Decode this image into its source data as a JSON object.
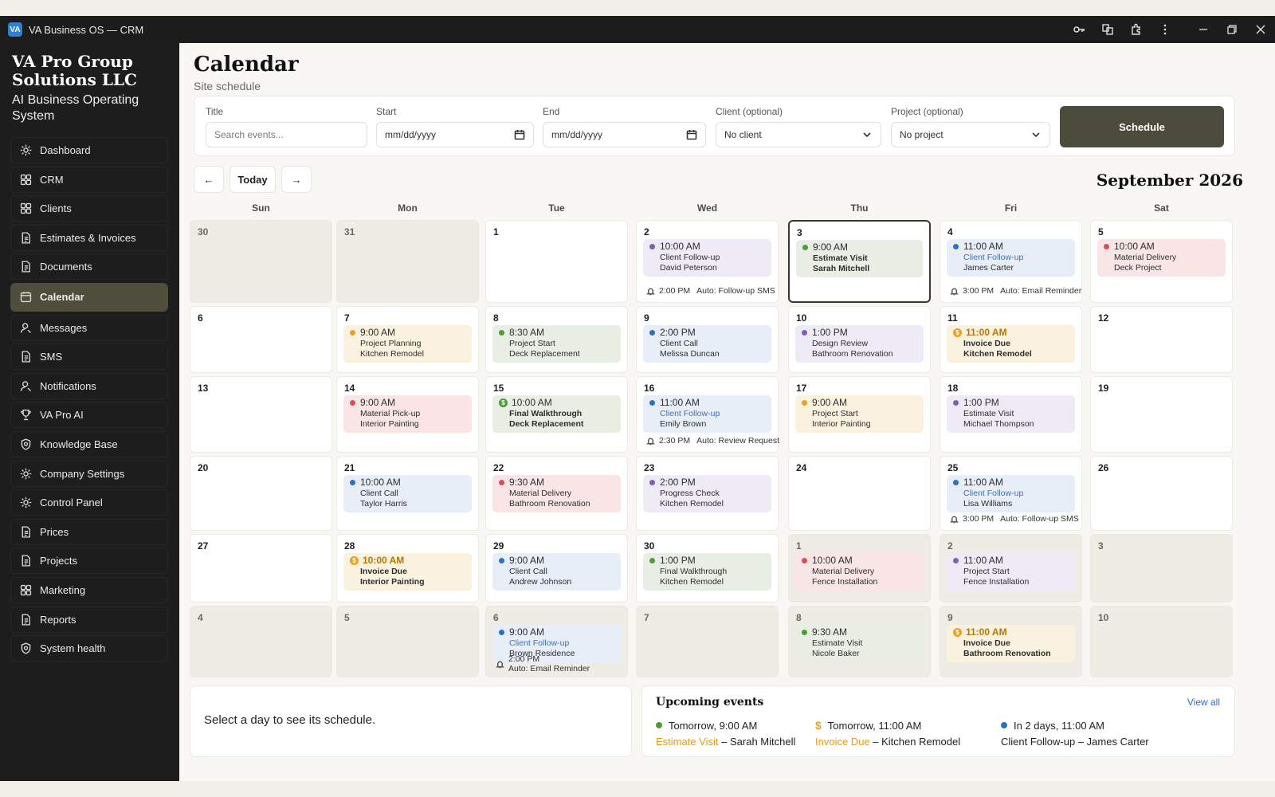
{
  "window": {
    "badge": "VA",
    "title": "VA Business OS — CRM"
  },
  "sidebar": {
    "company": "VA Pro Group Solutions LLC",
    "tagline": "AI Business Operating System",
    "items": [
      {
        "label": "Dashboard",
        "icon": "gear-icon"
      },
      {
        "label": "CRM",
        "icon": "grid-icon"
      },
      {
        "label": "Clients",
        "icon": "grid-icon"
      },
      {
        "label": "Estimates & Invoices",
        "icon": "document-icon"
      },
      {
        "label": "Documents",
        "icon": "document-icon"
      },
      {
        "label": "Calendar",
        "icon": "calendar-icon",
        "active": true
      },
      {
        "label": "Messages",
        "icon": "user-icon"
      },
      {
        "label": "SMS",
        "icon": "document-icon"
      },
      {
        "label": "Notifications",
        "icon": "user-icon"
      },
      {
        "label": "VA Pro AI",
        "icon": "trophy-icon"
      },
      {
        "label": "Knowledge Base",
        "icon": "shield-icon"
      },
      {
        "label": "Company Settings",
        "icon": "gear-icon"
      },
      {
        "label": "Control Panel",
        "icon": "gear-icon"
      },
      {
        "label": "Prices",
        "icon": "document-icon"
      },
      {
        "label": "Projects",
        "icon": "document-icon"
      },
      {
        "label": "Marketing",
        "icon": "grid-icon"
      },
      {
        "label": "Reports",
        "icon": "document-icon"
      },
      {
        "label": "System health",
        "icon": "shield-icon"
      }
    ]
  },
  "page": {
    "title": "Calendar",
    "subtitle": "Site schedule"
  },
  "form": {
    "title_label": "Title",
    "title_placeholder": "Search events...",
    "start_label": "Start",
    "start_value": "mm/dd/yyyy",
    "end_label": "End",
    "end_value": "mm/dd/yyyy",
    "client_label": "Client (optional)",
    "client_value": "No client",
    "project_label": "Project (optional)",
    "project_value": "No project",
    "schedule_label": "Schedule"
  },
  "calnav": {
    "prev": "←",
    "today": "Today",
    "next": "→",
    "month": "September 2026"
  },
  "weekdays": [
    "Sun",
    "Mon",
    "Tue",
    "Wed",
    "Thu",
    "Fri",
    "Sat"
  ],
  "colors": {
    "purple": "#7e5fb1",
    "blue": "#2c6fc1",
    "green": "#4e9b38",
    "orange": "#e8a125",
    "red": "#d05060",
    "accent": "#4c4c3c"
  },
  "weeks": [
    [
      {
        "day": "30",
        "out": true
      },
      {
        "day": "31",
        "out": true
      },
      {
        "day": "1"
      },
      {
        "day": "2",
        "events": [
          {
            "color": "purple",
            "time": "10:00 AM",
            "line1": "Client Follow-up",
            "line2": "David Peterson"
          }
        ],
        "reminder": {
          "time": "2:00 PM",
          "text": "Auto: Follow-up SMS"
        }
      },
      {
        "day": "3",
        "today": true,
        "events": [
          {
            "color": "green",
            "time": "9:00 AM",
            "line1": "Estimate Visit",
            "line2": "Sarah Mitchell",
            "bold": true
          }
        ]
      },
      {
        "day": "4",
        "events": [
          {
            "color": "blue",
            "time": "11:00 AM",
            "line1": "Client Follow-up",
            "line2": "James Carter"
          }
        ],
        "reminder": {
          "time": "3:00 PM",
          "text": "Auto: Email Reminder"
        }
      },
      {
        "day": "5",
        "events": [
          {
            "color": "red",
            "time": "10:00 AM",
            "line1": "Material Delivery",
            "line2": "Deck Project"
          }
        ]
      }
    ],
    [
      {
        "day": "6"
      },
      {
        "day": "7",
        "events": [
          {
            "color": "orange",
            "time": "9:00 AM",
            "line1": "Project Planning",
            "line2": "Kitchen Remodel"
          }
        ]
      },
      {
        "day": "8",
        "events": [
          {
            "color": "green",
            "time": "8:30 AM",
            "line1": "Project Start",
            "line2": "Deck Replacement"
          }
        ]
      },
      {
        "day": "9",
        "events": [
          {
            "color": "blue",
            "time": "2:00 PM",
            "line1": "Client Call",
            "line2": "Melissa Duncan"
          }
        ]
      },
      {
        "day": "10",
        "events": [
          {
            "color": "purple",
            "time": "1:00 PM",
            "line1": "Design Review",
            "line2": "Bathroom Renovation"
          }
        ]
      },
      {
        "day": "11",
        "events": [
          {
            "color": "orange",
            "time": "11:00 AM",
            "line1": "Invoice Due",
            "line2": "Kitchen Remodel",
            "coin": "$",
            "bold": true
          }
        ]
      },
      {
        "day": "12"
      }
    ],
    [
      {
        "day": "13"
      },
      {
        "day": "14",
        "events": [
          {
            "color": "red",
            "time": "9:00 AM",
            "line1": "Material Pick-up",
            "line2": "Interior Painting"
          }
        ]
      },
      {
        "day": "15",
        "events": [
          {
            "color": "green",
            "time": "10:00 AM",
            "line1": "Final Walkthrough",
            "line2": "Deck Replacement",
            "coin": "$",
            "bold": true
          }
        ]
      },
      {
        "day": "16",
        "events": [
          {
            "color": "blue",
            "time": "11:00 AM",
            "line1": "Client Follow-up",
            "line2": "Emily Brown"
          }
        ],
        "reminder": {
          "time": "2:30 PM",
          "text": "Auto: Review Request"
        }
      },
      {
        "day": "17",
        "events": [
          {
            "color": "orange",
            "time": "9:00 AM",
            "line1": "Project Start",
            "line2": "Interior Painting"
          }
        ]
      },
      {
        "day": "18",
        "events": [
          {
            "color": "purple",
            "time": "1:00 PM",
            "line1": "Estimate Visit",
            "line2": "Michael Thompson"
          }
        ]
      },
      {
        "day": "19"
      }
    ],
    [
      {
        "day": "20"
      },
      {
        "day": "21",
        "events": [
          {
            "color": "blue",
            "time": "10:00 AM",
            "line1": "Client Call",
            "line2": "Taylor Harris"
          }
        ]
      },
      {
        "day": "22",
        "events": [
          {
            "color": "red",
            "time": "9:30 AM",
            "line1": "Material Delivery",
            "line2": "Bathroom Renovation"
          }
        ]
      },
      {
        "day": "23",
        "events": [
          {
            "color": "purple",
            "time": "2:00 PM",
            "line1": "Progress Check",
            "line2": "Kitchen Remodel"
          }
        ]
      },
      {
        "day": "24"
      },
      {
        "day": "25",
        "events": [
          {
            "color": "blue",
            "time": "11:00 AM",
            "line1": "Client Follow-up",
            "line2": "Lisa Williams"
          }
        ],
        "reminder": {
          "time": "3:00 PM",
          "text": "Auto: Follow-up SMS"
        }
      },
      {
        "day": "26"
      }
    ],
    [
      {
        "day": "27"
      },
      {
        "day": "28",
        "events": [
          {
            "color": "orange",
            "time": "10:00 AM",
            "line1": "Invoice Due",
            "line2": "Interior Painting",
            "coin": "$",
            "bold": true
          }
        ]
      },
      {
        "day": "29",
        "events": [
          {
            "color": "blue",
            "time": "9:00 AM",
            "line1": "Client Call",
            "line2": "Andrew Johnson"
          }
        ]
      },
      {
        "day": "30",
        "events": [
          {
            "color": "green",
            "time": "1:00 PM",
            "line1": "Final Walkthrough",
            "line2": "Kitchen Remodel"
          }
        ]
      },
      {
        "day": "1",
        "out": true,
        "events": [
          {
            "color": "red",
            "time": "10:00 AM",
            "line1": "Material Delivery",
            "line2": "Fence Installation"
          }
        ]
      },
      {
        "day": "2",
        "out": true,
        "events": [
          {
            "color": "purple",
            "time": "11:00 AM",
            "line1": "Project Start",
            "line2": "Fence Installation"
          }
        ]
      },
      {
        "day": "3",
        "out": true
      }
    ],
    [
      {
        "day": "4",
        "out": true
      },
      {
        "day": "5",
        "out": true
      },
      {
        "day": "6",
        "out": true,
        "events": [
          {
            "color": "blue",
            "time": "9:00 AM",
            "line1": "Client Follow-up",
            "line2": "Brown Residence"
          }
        ],
        "reminder": {
          "time": "2:00 PM",
          "text": "Auto: Email Reminder",
          "stacked": true
        }
      },
      {
        "day": "7",
        "out": true
      },
      {
        "day": "8",
        "out": true,
        "events": [
          {
            "color": "green",
            "time": "9:30 AM",
            "line1": "Estimate Visit",
            "line2": "Nicole Baker"
          }
        ]
      },
      {
        "day": "9",
        "out": true,
        "events": [
          {
            "color": "orange",
            "time": "11:00 AM",
            "line1": "Invoice Due",
            "line2": "Bathroom Renovation",
            "coin": "$",
            "bold": true
          }
        ]
      },
      {
        "day": "10",
        "out": true
      }
    ]
  ],
  "selection": {
    "text": "Select a day to see its schedule."
  },
  "upcoming": {
    "title": "Upcoming events",
    "view_all": "View all",
    "items": [
      {
        "when": "Tomorrow, 9:00 AM",
        "type": "Estimate Visit",
        "sep": " – ",
        "who": "Sarah Mitchell",
        "color": "green"
      },
      {
        "when": "Tomorrow, 11:00 AM",
        "type": "Invoice Due",
        "sep": " – ",
        "who": "Kitchen Remodel",
        "color": "orange",
        "dollar": "$"
      },
      {
        "when": "In 2 days, 11:00 AM",
        "type": "Client Follow-up",
        "sep": " – ",
        "who": "James Carter",
        "color": "blue"
      }
    ]
  }
}
